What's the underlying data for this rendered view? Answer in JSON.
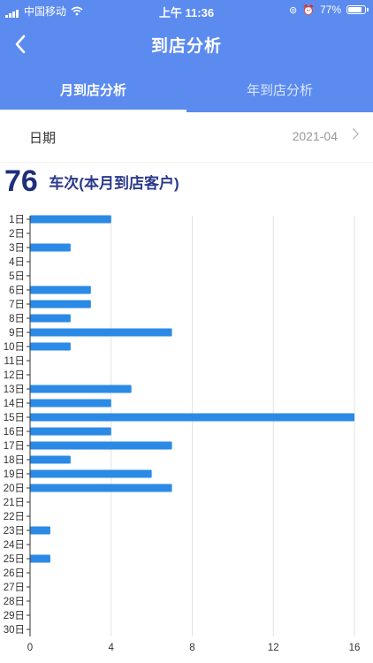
{
  "status": {
    "carrier": "中国移动",
    "time": "上午 11:36",
    "battery": "77%",
    "battery_level": 0.77
  },
  "nav": {
    "title": "到店分析",
    "back_icon": "chevron-left-icon"
  },
  "tabs": [
    {
      "label": "月到店分析",
      "active": true
    },
    {
      "label": "年到店分析",
      "active": false
    }
  ],
  "date_row": {
    "label": "日期",
    "value": "2021-04"
  },
  "summary": {
    "count": "76",
    "label": "车次(本月到店客户)"
  },
  "colors": {
    "header": "#5b8bef",
    "bar": "#2b8ae6",
    "count": "#1f2f7a"
  },
  "chart_data": {
    "type": "bar",
    "orientation": "horizontal",
    "categories": [
      "1日",
      "2日",
      "3日",
      "4日",
      "5日",
      "6日",
      "7日",
      "8日",
      "9日",
      "10日",
      "11日",
      "12日",
      "13日",
      "14日",
      "15日",
      "16日",
      "17日",
      "18日",
      "19日",
      "20日",
      "21日",
      "22日",
      "23日",
      "24日",
      "25日",
      "26日",
      "27日",
      "28日",
      "29日",
      "30日"
    ],
    "values": [
      4,
      0,
      2,
      0,
      0,
      3,
      3,
      2,
      7,
      2,
      0,
      0,
      5,
      4,
      16,
      4,
      7,
      2,
      6,
      7,
      0,
      0,
      1,
      0,
      1,
      0,
      0,
      0,
      0,
      0
    ],
    "xlim": [
      0,
      16
    ],
    "xticks": [
      0,
      4,
      8,
      12,
      16
    ],
    "grid": true
  }
}
